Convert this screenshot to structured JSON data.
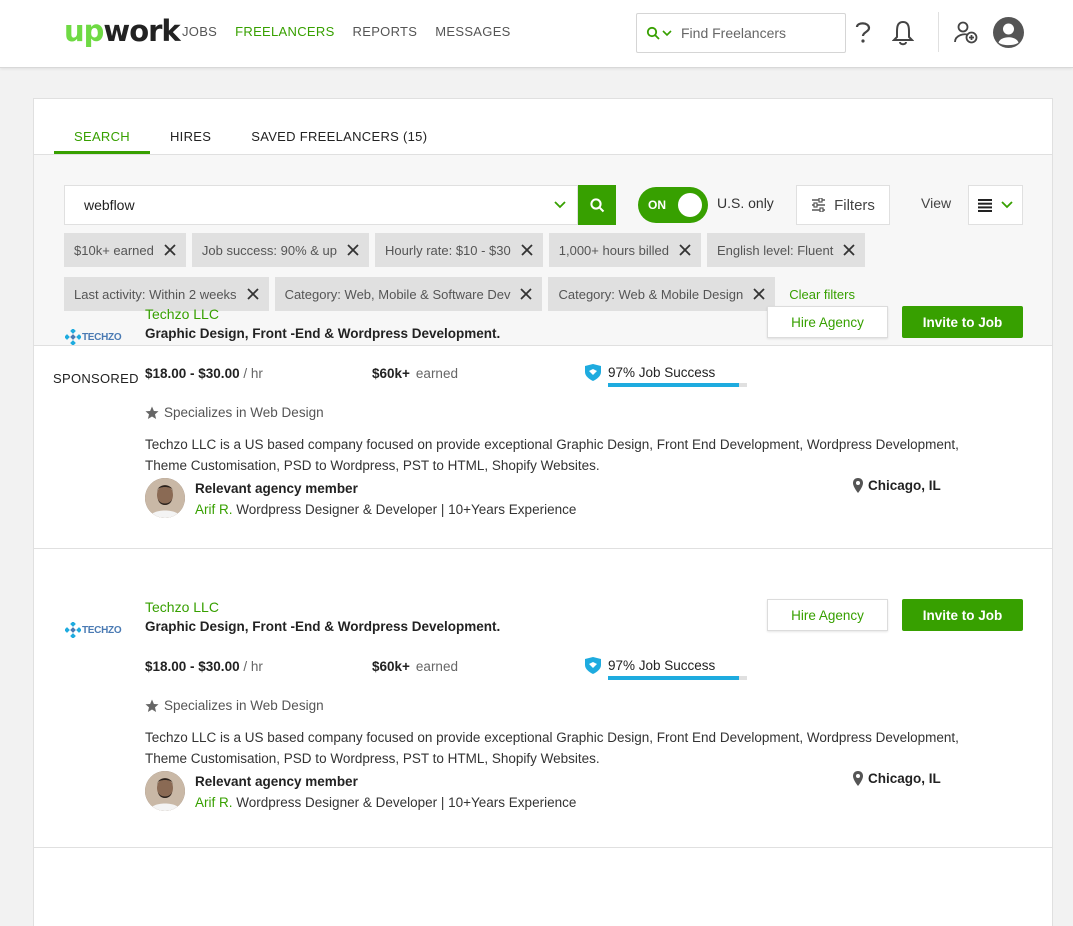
{
  "header": {
    "logo_up": "up",
    "logo_work": "work",
    "nav": [
      "JOBS",
      "FREELANCERS",
      "REPORTS",
      "MESSAGES"
    ],
    "active_nav": "FREELANCERS",
    "search_placeholder": "Find Freelancers"
  },
  "tabs": [
    "SEARCH",
    "HIRES",
    "SAVED FREELANCERS (15)"
  ],
  "search": {
    "query": "webflow",
    "toggle_label": "ON",
    "us_only": "U.S. only",
    "filters_label": "Filters",
    "view_label": "View"
  },
  "chips_row1": [
    "$10k+ earned",
    "Job success: 90% & up",
    "Hourly rate: $10 - $30",
    "1,000+ hours billed",
    "English level: Fluent"
  ],
  "chips_row2": [
    "Last activity: Within 2 weeks",
    "Category: Web, Mobile & Software Dev",
    "Category: Web & Mobile Design"
  ],
  "clear_filters": "Clear filters",
  "sponsored": "SPONSORED",
  "results": [
    {
      "logo_text": "TECHZO",
      "company": "Techzo LLC",
      "title": "Graphic Design, Front -End & Wordpress Development.",
      "rate": "$18.00 - $30.00",
      "rate_unit": "/ hr",
      "earned_amount": "$60k+",
      "earned_label": "earned",
      "job_success": "97% Job Success",
      "job_success_pct": 0.94,
      "specializes": "Specializes in Web Design",
      "description": "Techzo LLC is a US based company focused on provide exceptional Graphic Design, Front End Development, Wordpress Development, Theme Customisation, PSD to Wordpress, PST to HTML, Shopify Websites.",
      "member_label": "Relevant agency member",
      "member_name": "Arif R.",
      "member_title": "Wordpress Designer & Developer | 10+Years Experience",
      "location": "Chicago, IL",
      "hire_label": "Hire Agency",
      "invite_label": "Invite to Job"
    },
    {
      "logo_text": "TECHZO",
      "company": "Techzo LLC",
      "title": "Graphic Design, Front -End & Wordpress Development.",
      "rate": "$18.00 - $30.00",
      "rate_unit": "/ hr",
      "earned_amount": "$60k+",
      "earned_label": "earned",
      "job_success": "97% Job Success",
      "job_success_pct": 0.94,
      "specializes": "Specializes in Web Design",
      "description": "Techzo LLC is a US based company focused on provide exceptional Graphic Design, Front End Development, Wordpress Development, Theme Customisation, PSD to Wordpress, PST to HTML, Shopify Websites.",
      "member_label": "Relevant agency member",
      "member_name": "Arif R.",
      "member_title": "Wordpress Designer & Developer | 10+Years Experience",
      "location": "Chicago, IL",
      "hire_label": "Hire Agency",
      "invite_label": "Invite to Job"
    }
  ],
  "colors": {
    "brand_green": "#37a000",
    "logo_green": "#6fda44",
    "success_blue": "#1eabdf"
  }
}
